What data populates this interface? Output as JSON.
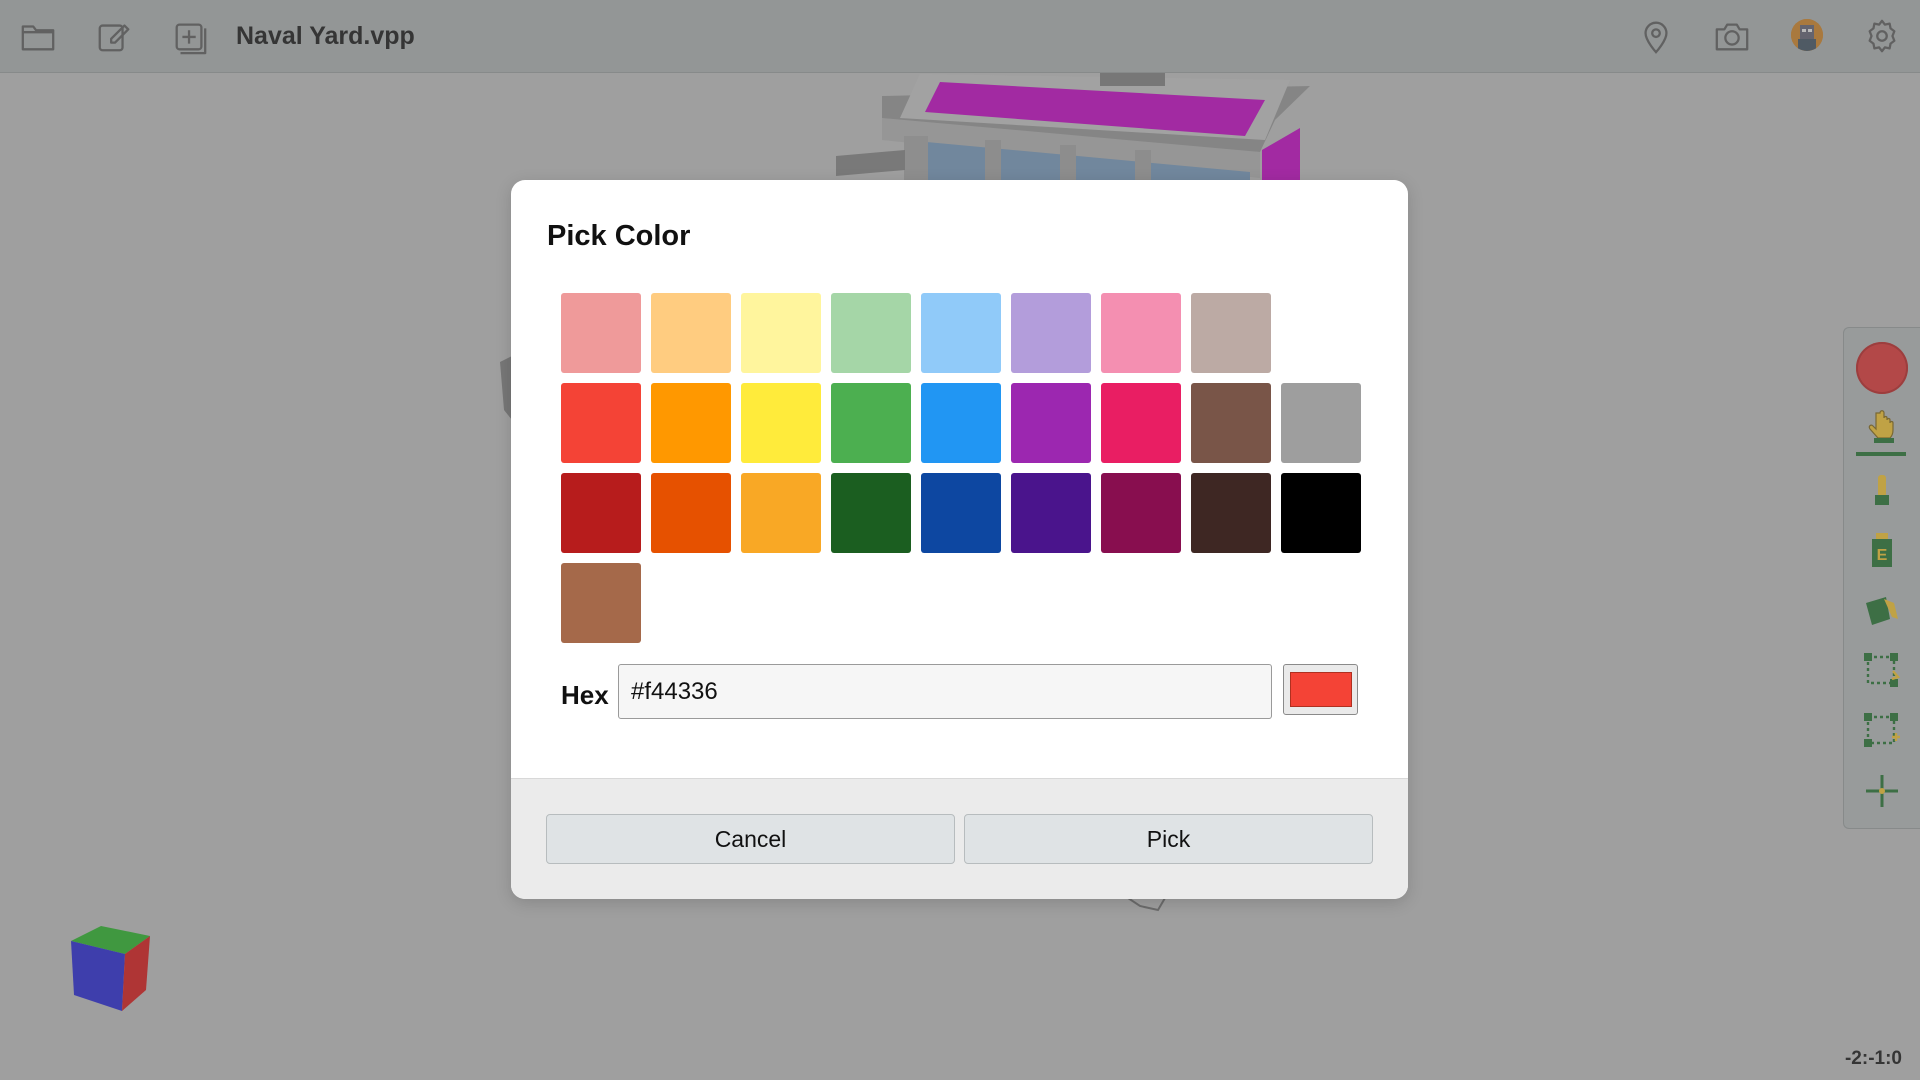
{
  "toolbar": {
    "title": "Naval Yard.vpp",
    "left_icons": [
      "folder-icon",
      "edit-icon",
      "add-layer-icon"
    ],
    "right_icons": [
      "location-pin-icon",
      "camera-icon",
      "avatar",
      "gear-icon"
    ]
  },
  "scene": {
    "coords": "-2:-1:0",
    "roof_color": "#b800b8"
  },
  "side_tools": {
    "current_color": "#d32f2f",
    "items": [
      "color-picker",
      "hand-tool-icon",
      "single-block-tool-icon",
      "fill-tool-icon",
      "paint-bucket-icon",
      "select-area-icon",
      "select-area-add-icon",
      "move-cross-icon"
    ]
  },
  "dialog": {
    "title": "Pick Color",
    "swatches": [
      [
        "#ef9a9a",
        "#ffcc80",
        "#fff59d",
        "#a5d6a7",
        "#90caf9",
        "#b39ddb",
        "#f48fb1",
        "#bcaaa4"
      ],
      [
        "#f44336",
        "#ff9800",
        "#ffeb3b",
        "#4caf50",
        "#2196f3",
        "#9c27b0",
        "#e91e63",
        "#795548",
        "#9e9e9e"
      ],
      [
        "#b71c1c",
        "#e65100",
        "#f9a825",
        "#1b5e20",
        "#0d47a1",
        "#4a148c",
        "#880e4f",
        "#3e2723",
        "#000000"
      ],
      [
        "#a5694a"
      ]
    ],
    "hex_label": "Hex",
    "hex_value": "#f44336",
    "cancel_label": "Cancel",
    "pick_label": "Pick"
  }
}
